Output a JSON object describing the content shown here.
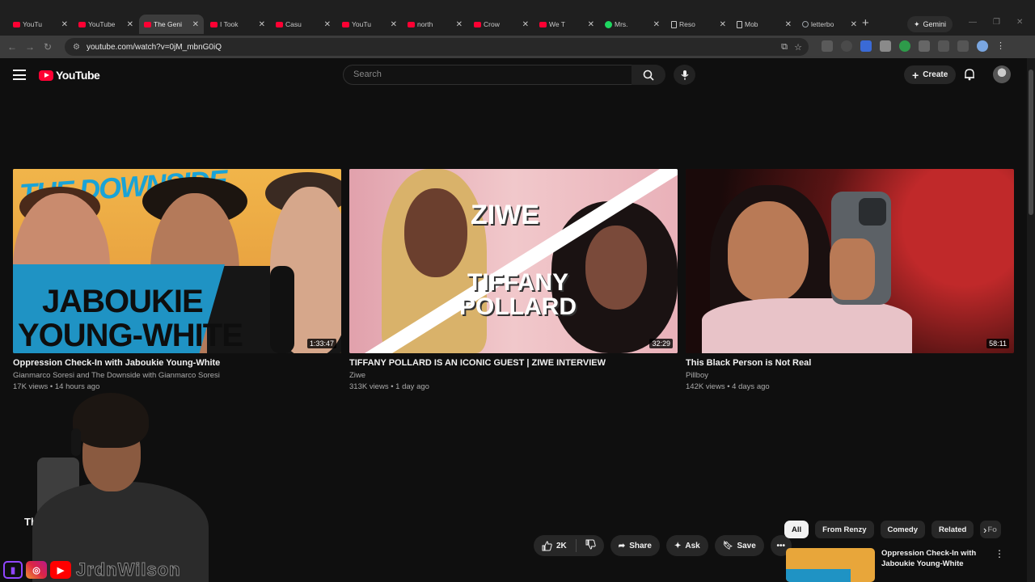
{
  "browser": {
    "tabs": [
      {
        "label": "YouTu",
        "icon": "youtube-icon"
      },
      {
        "label": "YouTube",
        "icon": "youtube-icon"
      },
      {
        "label": "The Geni",
        "icon": "youtube-icon",
        "active": true
      },
      {
        "label": "I Took",
        "icon": "youtube-icon"
      },
      {
        "label": "Casu",
        "icon": "youtube-icon"
      },
      {
        "label": "YouTu",
        "icon": "youtube-icon"
      },
      {
        "label": "north",
        "icon": "youtube-icon"
      },
      {
        "label": "Crow",
        "icon": "youtube-icon"
      },
      {
        "label": "We T",
        "icon": "youtube-icon"
      },
      {
        "label": "Mrs.",
        "icon": "spotify-icon"
      },
      {
        "label": "Reso",
        "icon": "mobile-icon"
      },
      {
        "label": "Mob",
        "icon": "mobile-icon"
      },
      {
        "label": "letterbo",
        "icon": "globe-icon"
      }
    ],
    "new_tab": "+",
    "gemini_label": "Gemini",
    "url": "youtube.com/watch?v=0jM_mbnG0iQ"
  },
  "youtube": {
    "logo_text": "YouTube",
    "search_placeholder": "Search",
    "create_label": "Create",
    "brand_color": "#ff0033"
  },
  "videos": [
    {
      "title": "Oppression Check-In with Jaboukie Young-White",
      "channel": "Gianmarco Soresi and The Downside with Gianmarco Soresi",
      "meta": "17K views • 14 hours ago",
      "duration": "1:33:47",
      "thumb_text": [
        "THE DOWNSIDE",
        "JABOUKIE",
        "YOUNG-WHITE"
      ]
    },
    {
      "title": "TIFFANY POLLARD IS AN ICONIC GUEST | ZIWE INTERVIEW",
      "channel": "Ziwe",
      "meta": "313K views • 1 day ago",
      "duration": "32:29",
      "thumb_text": [
        "ZIWE",
        "TIFFANY",
        "POLLARD"
      ]
    },
    {
      "title": "This Black Person is Not Real",
      "channel": "Pillboy",
      "meta": "142K views • 4 days ago",
      "duration": "58:11"
    }
  ],
  "watch": {
    "title_fragment": "Th",
    "like_count": "2K",
    "share_label": "Share",
    "ask_label": "Ask",
    "save_label": "Save"
  },
  "overlay": {
    "handle": "JrdnWilson"
  },
  "chips": [
    "All",
    "From Renzy",
    "Comedy",
    "Related",
    "Fo"
  ],
  "related": [
    {
      "title": "Oppression Check-In with Jaboukie Young-White"
    }
  ]
}
